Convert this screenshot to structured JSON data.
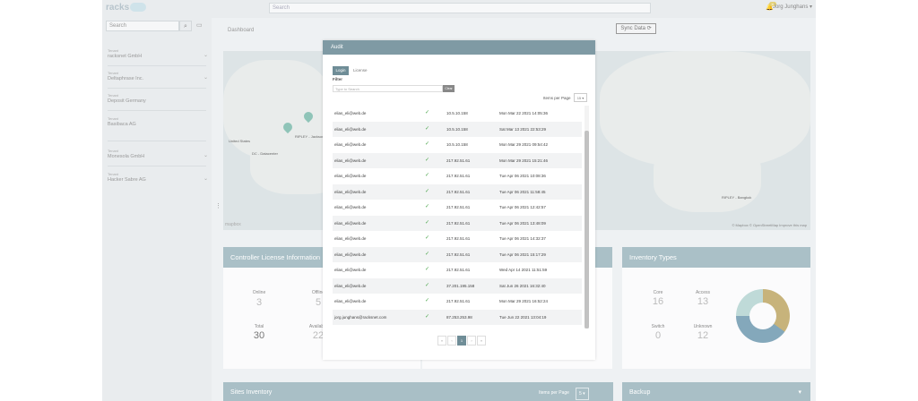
{
  "topbar": {
    "logo": "racks",
    "search_placeholder": "Search",
    "user": "Jorg Junghans ▾",
    "notif_count": "11"
  },
  "sidebar": {
    "search_placeholder": "Search",
    "tenant_label": "Tenant",
    "tenants": [
      "racksnet GmbH",
      "Deltaphrase Inc.",
      "Deposit Germany",
      "Basibaca AG",
      "Monesola GmbH",
      "Hacker Sabre AG"
    ]
  },
  "main": {
    "dashboard_title": "Dashboard",
    "sync_label": "Sync Data ⟳",
    "map": {
      "labels": {
        "united_states": "United States",
        "dc": "DC - Datacenter",
        "ripley": "RIPLEY - Jackson",
        "ripley2": "RIPLEY - Bangkok"
      },
      "attribution": "© Mapbox © OpenStreetMap Improve this map",
      "mapbox_mark": "mapbox"
    },
    "license_panel": {
      "title": "Controller License Information",
      "online_label": "Online",
      "online_value": "3",
      "offline_label": "Offline",
      "offline_value": "5",
      "total_label": "Total",
      "total_value": "30",
      "available_label": "Available",
      "available_value": "22"
    },
    "inventory_panel": {
      "title": "Inventory Types",
      "core_label": "Core",
      "core_value": "16",
      "access_label": "Access",
      "access_value": "13",
      "switch_label": "Switch",
      "switch_value": "0",
      "unknown_label": "Unknown",
      "unknown_value": "12"
    },
    "sites_inventory": {
      "title": "Sites Inventory",
      "items_per_page": "Items per Page",
      "ipp_value": "5 ▾"
    },
    "backup": {
      "title": "Backup"
    }
  },
  "modal": {
    "title": "Audit",
    "tab_login": "Login",
    "tab_license": "License",
    "filter_label": "Filter",
    "filter_placeholder": "Type to Search",
    "filter_button": "Clear",
    "items_per_page": "Items per Page",
    "ipp_value": "15 ▾",
    "rows": [
      {
        "user": "elias_eli@web.de",
        "ip": "10.5.10.158",
        "time": "Mon Mar 22 2021 14:05:36"
      },
      {
        "user": "elias_eli@web.de",
        "ip": "10.5.10.158",
        "time": "Sat Mar 13 2021 22:53:29"
      },
      {
        "user": "elias_eli@web.de",
        "ip": "10.5.10.158",
        "time": "Mon Mar 29 2021 09:54:42"
      },
      {
        "user": "elias_eli@web.de",
        "ip": "217.92.51.61",
        "time": "Mon Mar 29 2021 15:21:46"
      },
      {
        "user": "elias_eli@web.de",
        "ip": "217.92.51.61",
        "time": "Tue Apr 06 2021 10:08:36"
      },
      {
        "user": "elias_eli@web.de",
        "ip": "217.92.51.61",
        "time": "Tue Apr 06 2021 11:58:45"
      },
      {
        "user": "elias_eli@web.de",
        "ip": "217.92.51.61",
        "time": "Tue Apr 06 2021 12:42:57"
      },
      {
        "user": "elias_eli@web.de",
        "ip": "217.92.51.61",
        "time": "Tue Apr 06 2021 13:48:09"
      },
      {
        "user": "elias_eli@web.de",
        "ip": "217.92.51.61",
        "time": "Tue Apr 06 2021 14:32:37"
      },
      {
        "user": "elias_eli@web.de",
        "ip": "217.92.51.61",
        "time": "Tue Apr 06 2021 15:17:29"
      },
      {
        "user": "elias_eli@web.de",
        "ip": "217.92.51.61",
        "time": "Wed Apr 14 2021 11:51:59"
      },
      {
        "user": "elias_eli@web.de",
        "ip": "37.201.195.158",
        "time": "Sat Jun 26 2021 16:32:40"
      },
      {
        "user": "elias_eli@web.de",
        "ip": "217.92.51.61",
        "time": "Mon Mar 29 2021 16:52:24"
      },
      {
        "user": "jorg.junghans@racksnet.com",
        "ip": "87.253.253.98",
        "time": "Tue Jun 22 2021 13:04:19"
      }
    ],
    "check_icon": "✓",
    "pager": {
      "first": "«",
      "prev": "‹",
      "current": "1",
      "next": "›",
      "last": "»"
    }
  },
  "colors": {
    "header": "#aac0c7",
    "modal_header": "#7f9aa4",
    "accent": "#6f8d97",
    "pin_green": "#8fc4b8",
    "pin_gold": "#c7b37b"
  }
}
